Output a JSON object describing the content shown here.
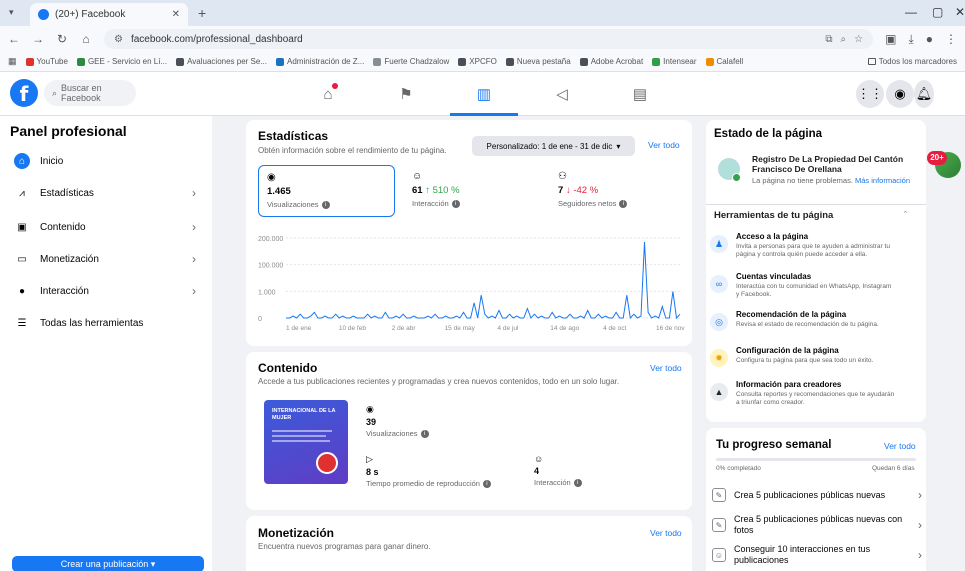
{
  "browser": {
    "tab_title": "(20+) Facebook",
    "tab_close": "✕",
    "new_tab": "+",
    "url": "facebook.com/professional_dashboard",
    "bookmarks": [
      "YouTube",
      "GEE - Servicio en Lí...",
      "Avaluaciones per Se...",
      "Administración de Z...",
      "Fuerte Chadzalow",
      "XPCFO",
      "Nueva pestaña",
      "Adobe Acrobat",
      "Intensear",
      "Calafell"
    ],
    "bookmarks_right": "Todos los marcadores"
  },
  "fbnav": {
    "search_placeholder": "Buscar en Facebook",
    "notif_badge": "20+"
  },
  "sidebar": {
    "title": "Panel profesional",
    "items": [
      {
        "label": "Inicio",
        "icon": "home-icon",
        "active": true,
        "chevron": false
      },
      {
        "label": "Estadísticas",
        "icon": "chart-icon",
        "active": false,
        "chevron": true
      },
      {
        "label": "Contenido",
        "icon": "content-icon",
        "active": false,
        "chevron": true
      },
      {
        "label": "Monetización",
        "icon": "money-icon",
        "active": false,
        "chevron": true
      },
      {
        "label": "Interacción",
        "icon": "interaction-icon",
        "active": false,
        "chevron": true
      },
      {
        "label": "Todas las herramientas",
        "icon": "tools-icon",
        "active": false,
        "chevron": false
      }
    ],
    "create_button": "Crear una publicación"
  },
  "stats": {
    "title": "Estadísticas",
    "subtitle": "Obtén información sobre el rendimiento de tu página.",
    "period": "Personalizado: 1 de ene - 31 de dic",
    "see_all": "Ver todo",
    "metrics": [
      {
        "value": "1.465",
        "change": "",
        "change_dir": "",
        "label": "Visualizaciones",
        "icon": "eye-icon"
      },
      {
        "value": "61",
        "change": "↑ 510 %",
        "change_dir": "up",
        "label": "Interacción",
        "icon": "smile-icon"
      },
      {
        "value": "7",
        "change": "↓ -42 %",
        "change_dir": "down",
        "label": "Seguidores netos",
        "icon": "people-icon"
      }
    ]
  },
  "chart_data": {
    "type": "line",
    "title": "",
    "xlabel": "",
    "ylabel": "",
    "y_ticks": [
      "200.000",
      "100.000",
      "1.000",
      "0"
    ],
    "x_ticks": [
      "1 de ene",
      "10 de feb",
      "2 de abr",
      "15 de may",
      "4 de jul",
      "14 de ago",
      "4 de oct",
      "16 de nov"
    ],
    "series": [
      {
        "values": [
          0,
          0,
          1,
          0,
          2,
          0,
          0,
          1,
          3,
          0,
          0,
          1,
          0,
          0,
          2,
          0,
          1,
          0,
          0,
          1,
          0,
          0,
          0,
          2,
          0,
          1,
          0,
          0,
          3,
          0,
          0,
          1,
          0,
          2,
          0,
          0,
          1,
          0,
          0,
          0,
          1,
          0,
          2,
          0,
          0,
          1,
          0,
          0,
          1,
          0,
          3,
          0,
          0,
          8,
          0,
          12,
          2,
          0,
          1,
          0,
          4,
          0,
          0,
          2,
          0,
          1,
          0,
          0,
          5,
          0,
          2,
          0,
          1,
          0,
          0,
          3,
          0,
          1,
          0,
          0,
          2,
          0,
          0,
          1,
          0,
          4,
          0,
          0,
          2,
          0,
          1,
          0,
          0,
          3,
          0,
          0,
          12,
          0,
          2,
          0,
          1,
          40,
          3,
          0,
          1,
          0,
          6,
          0,
          0,
          14,
          0,
          2
        ]
      }
    ]
  },
  "content": {
    "title": "Contenido",
    "subtitle": "Accede a tus publicaciones recientes y programadas y crea nuevos contenidos, todo en un solo lugar.",
    "see_all": "Ver todo",
    "thumb_text": "INTERNACIONAL DE LA MUJER",
    "views_value": "39",
    "views_label": "Visualizaciones",
    "avg_time_value": "8 s",
    "avg_time_label": "Tiempo promedio de reproducción",
    "interaction_value": "4",
    "interaction_label": "Interacción"
  },
  "monetization": {
    "title": "Monetización",
    "subtitle": "Encuentra nuevos programas para ganar dinero.",
    "see_all": "Ver todo"
  },
  "page_state": {
    "title": "Estado de la página",
    "page_name": "Registro De La Propiedad Del Cantón Francisco De Orellana",
    "status_text": "La página no tiene problemas.",
    "status_link": "Más información"
  },
  "tools": {
    "title": "Herramientas de tu página",
    "items": [
      {
        "title": "Acceso a la página",
        "desc": "Invita a personas para que te ayuden a administrar tu página y controla quién puede acceder a ella.",
        "icon": "person-icon"
      },
      {
        "title": "Cuentas vinculadas",
        "desc": "Interactúa con tu comunidad en WhatsApp, Instagram y Facebook.",
        "icon": "link-icon"
      },
      {
        "title": "Recomendación de la página",
        "desc": "Revisa el estado de recomendación de tu página.",
        "icon": "recommend-icon"
      },
      {
        "title": "Configuración de la página",
        "desc": "Configura tu página para que sea todo un éxito.",
        "icon": "settings-icon"
      },
      {
        "title": "Información para creadores",
        "desc": "Consulta reportes y recomendaciones que te ayudarán a triunfar como creador.",
        "icon": "graduation-icon"
      }
    ]
  },
  "progress": {
    "title": "Tu progreso semanal",
    "see_all": "Ver todo",
    "left_meta": "0% completado",
    "right_meta": "Quedan 6 días",
    "tasks": [
      "Crea 5 publicaciones públicas nuevas",
      "Crea 5 publicaciones públicas nuevas con fotos",
      "Conseguir 10 interacciones en tus publicaciones"
    ]
  }
}
